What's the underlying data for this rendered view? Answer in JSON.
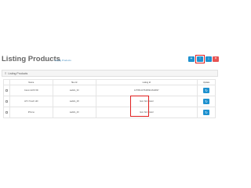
{
  "header": {
    "title": "Listing Products",
    "breadcrumb": {
      "home": "Home",
      "sep": "»",
      "current": "Listing Products"
    }
  },
  "toolbar": {
    "buttons": [
      {
        "icon": "plus-icon",
        "glyph": "+",
        "color": "#1e91cf"
      },
      {
        "icon": "upload-icon",
        "glyph": "↑",
        "color": "#1e91cf",
        "highlighted": true
      },
      {
        "icon": "download-icon",
        "glyph": "↓",
        "color": "#1e91cf"
      },
      {
        "icon": "delete-icon",
        "glyph": "×",
        "color": "#e65454"
      }
    ]
  },
  "panel": {
    "icon": "list-icon",
    "glyph": "≡",
    "heading": "Listing Products"
  },
  "table": {
    "columns": [
      "",
      "Name",
      "Sku Id",
      "Listing Id",
      "Update"
    ],
    "rows": [
      {
        "name": "Canon EOS 5D",
        "sku": "sadsfs_30",
        "listing": "1276514376466914642827",
        "not_listed": false,
        "checked": false
      },
      {
        "name": "HTC Touch HD",
        "sku": "sadsfs_28",
        "listing": "Item Not Listed",
        "not_listed": true,
        "checked": true
      },
      {
        "name": "iPhone",
        "sku": "sadsfs_40",
        "listing": "Item Not Listed",
        "not_listed": true,
        "checked": false
      }
    ],
    "update_glyph": "↻"
  },
  "colors": {
    "primary": "#1e91cf",
    "danger": "#e65454",
    "highlight": "#e02020"
  }
}
